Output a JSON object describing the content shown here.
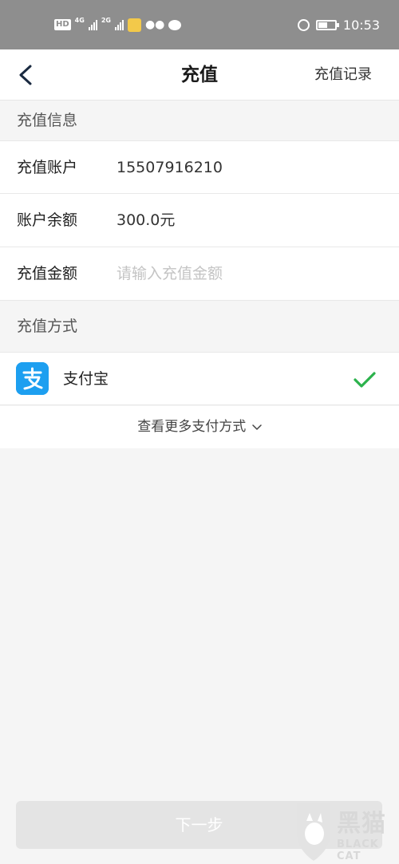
{
  "status_bar": {
    "hd": "HD",
    "net1": "4G",
    "net2": "2G",
    "time": "10:53"
  },
  "nav": {
    "title": "充值",
    "right_link": "充值记录"
  },
  "recharge_info": {
    "header": "充值信息",
    "account_label": "充值账户",
    "account_value": "15507916210",
    "balance_label": "账户余额",
    "balance_value": "300.0元",
    "amount_label": "充值金额",
    "amount_placeholder": "请输入充值金额",
    "amount_value": ""
  },
  "payment": {
    "header": "充值方式",
    "methods": [
      {
        "name": "支付宝",
        "icon": "alipay-icon",
        "selected": true
      }
    ],
    "more_label": "查看更多支付方式"
  },
  "next_button": {
    "label": "下一步",
    "enabled": false
  },
  "watermark": {
    "cn": "黑猫",
    "en": "BLACK CAT"
  },
  "colors": {
    "status_bar": "#8e8e8e",
    "accent_blue": "#1d9ff0",
    "check_green": "#2bb24c",
    "disabled_button": "#e4e4e4"
  }
}
